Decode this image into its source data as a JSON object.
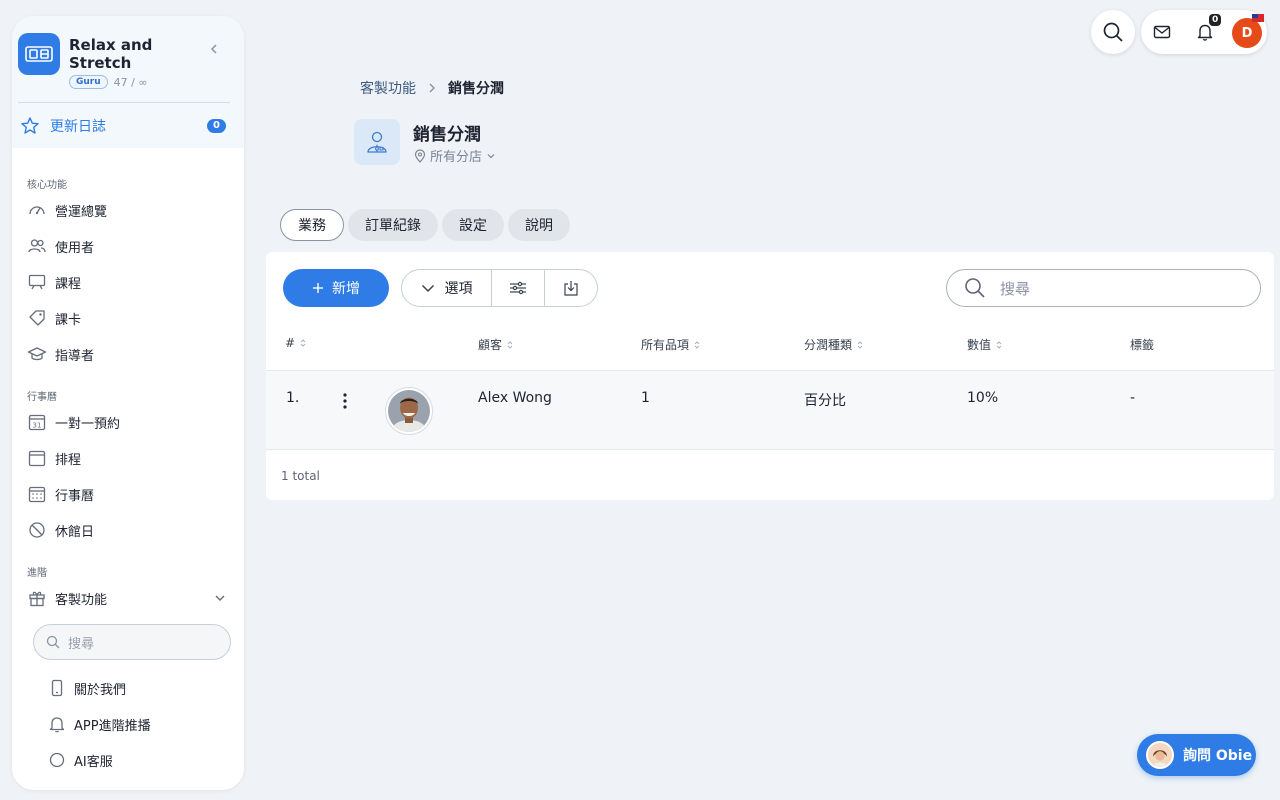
{
  "brand": {
    "name": "Relax and Stretch",
    "tier": "Guru",
    "count": "47 / ∞",
    "logo_text": "OB"
  },
  "changelog": {
    "label": "更新日誌",
    "count": "0"
  },
  "sidebar": {
    "sections": [
      {
        "title": "核心功能",
        "items": [
          {
            "label": "營運總覽",
            "icon": "dashboard-icon"
          },
          {
            "label": "使用者",
            "icon": "users-icon"
          },
          {
            "label": "課程",
            "icon": "presentation-icon"
          },
          {
            "label": "課卡",
            "icon": "tag-icon"
          },
          {
            "label": "指導者",
            "icon": "graduation-cap-icon"
          }
        ]
      },
      {
        "title": "行事曆",
        "items": [
          {
            "label": "一對一預約",
            "icon": "calendar-31-icon"
          },
          {
            "label": "排程",
            "icon": "calendar-icon"
          },
          {
            "label": "行事曆",
            "icon": "calendar-grid-icon"
          },
          {
            "label": "休館日",
            "icon": "block-icon"
          }
        ]
      },
      {
        "title": "進階",
        "items": [
          {
            "label": "客製功能",
            "icon": "gift-icon"
          }
        ]
      }
    ],
    "search_placeholder": "搜尋",
    "sub_items": [
      {
        "label": "關於我們",
        "icon": "phone-icon"
      },
      {
        "label": "APP進階推播",
        "icon": "bell-icon"
      },
      {
        "label": "AI客服",
        "icon": "chat-icon"
      }
    ]
  },
  "topbar": {
    "notification_count": "0",
    "avatar_initial": "D"
  },
  "breadcrumb": {
    "parent": "客製功能",
    "current": "銷售分潤"
  },
  "page": {
    "title": "銷售分潤",
    "location": "所有分店"
  },
  "tabs": [
    "業務",
    "訂單紀錄",
    "設定",
    "說明"
  ],
  "toolbar": {
    "add_label": "新增",
    "options_label": "選項",
    "search_placeholder": "搜尋"
  },
  "table": {
    "columns": [
      "#",
      "顧客",
      "所有品項",
      "分潤種類",
      "數值",
      "標籤"
    ],
    "rows": [
      {
        "index": "1.",
        "customer": "Alex Wong",
        "items": "1",
        "type": "百分比",
        "value": "10%",
        "tags": "-"
      }
    ],
    "total": "1 total"
  },
  "assistant": {
    "label": "詢問 Obie"
  },
  "colors": {
    "accent": "#2f7ce6",
    "background": "#eff2f6",
    "avatar": "#e64a19"
  }
}
